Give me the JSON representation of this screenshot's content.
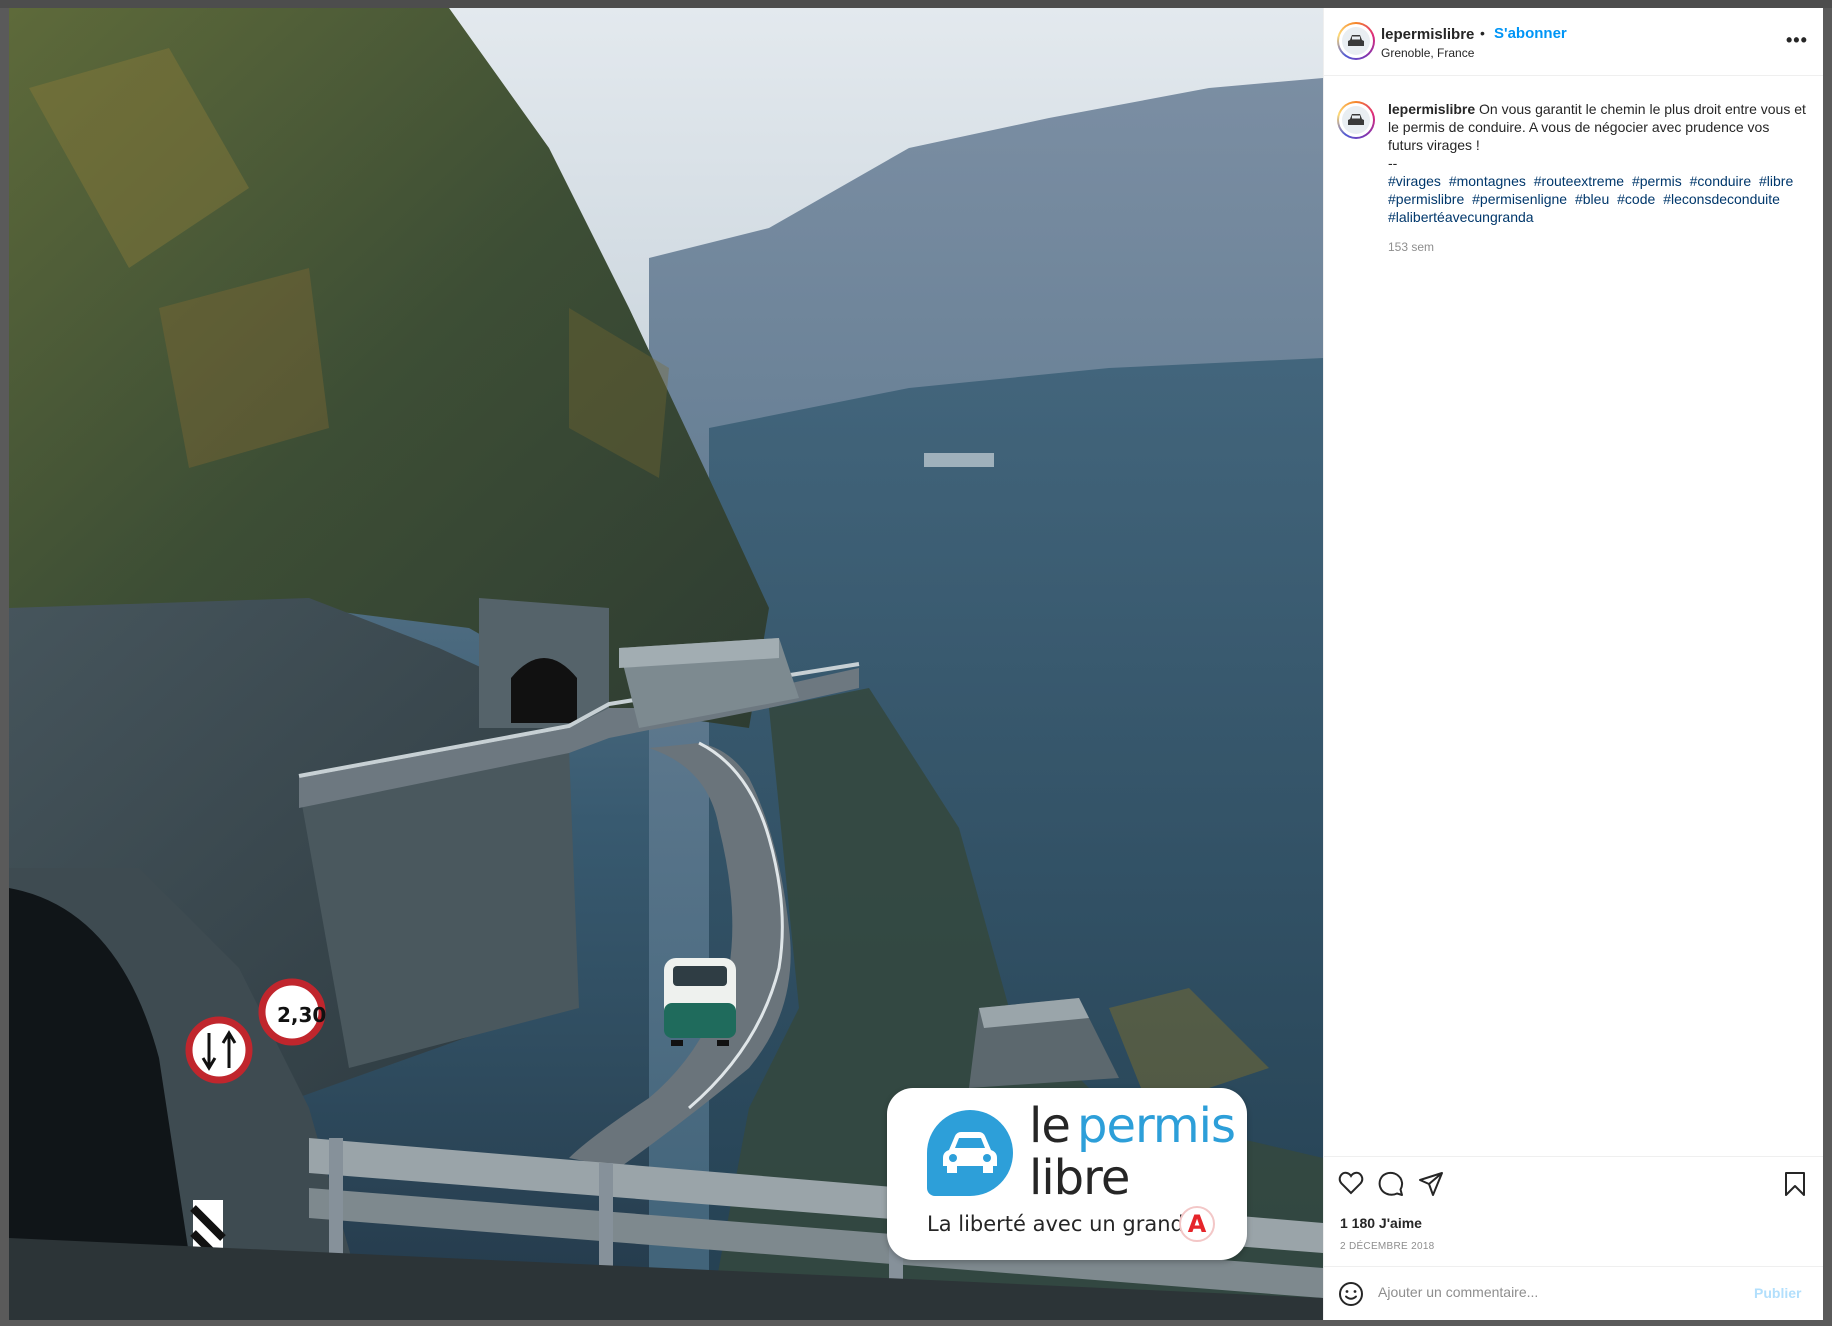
{
  "post": {
    "username": "lepermislibre",
    "separator": "•",
    "follow_label": "S'abonner",
    "location": "Grenoble, France",
    "more_label": "•••"
  },
  "caption": {
    "username": "lepermislibre",
    "text": "On vous garantit le chemin le plus droit entre vous et le permis de conduire. A vous de négocier avec prudence vos futurs virages !",
    "separator": "--",
    "hashtags": [
      "#virages",
      "#montagnes",
      "#routeextreme",
      "#permis",
      "#conduire",
      "#libre",
      "#permislibre",
      "#permisenligne",
      "#bleu",
      "#code",
      "#leconsdeconduite",
      "#lalibertéavecungranda"
    ],
    "time_ago": "153 sem"
  },
  "image_badge": {
    "brand_le": "le",
    "brand_permis": "permis",
    "brand_libre": "libre",
    "slogan": "La liberté avec un grand",
    "slogan_letter": "A",
    "brand_color": "#2d9fd9",
    "accent_color": "#e5252a"
  },
  "actions": {
    "icons": [
      "heart-icon",
      "comment-icon",
      "share-icon",
      "bookmark-icon"
    ],
    "likes": "1 180 J'aime",
    "date": "2 DÉCEMBRE 2018"
  },
  "comment": {
    "placeholder": "Ajouter un commentaire...",
    "publish_label": "Publier",
    "emoji_icon": "smiley-icon"
  },
  "colors": {
    "link_blue": "#0095f6",
    "hashtag_blue": "#00376b",
    "muted": "#8e8e8e",
    "text": "#262626"
  }
}
